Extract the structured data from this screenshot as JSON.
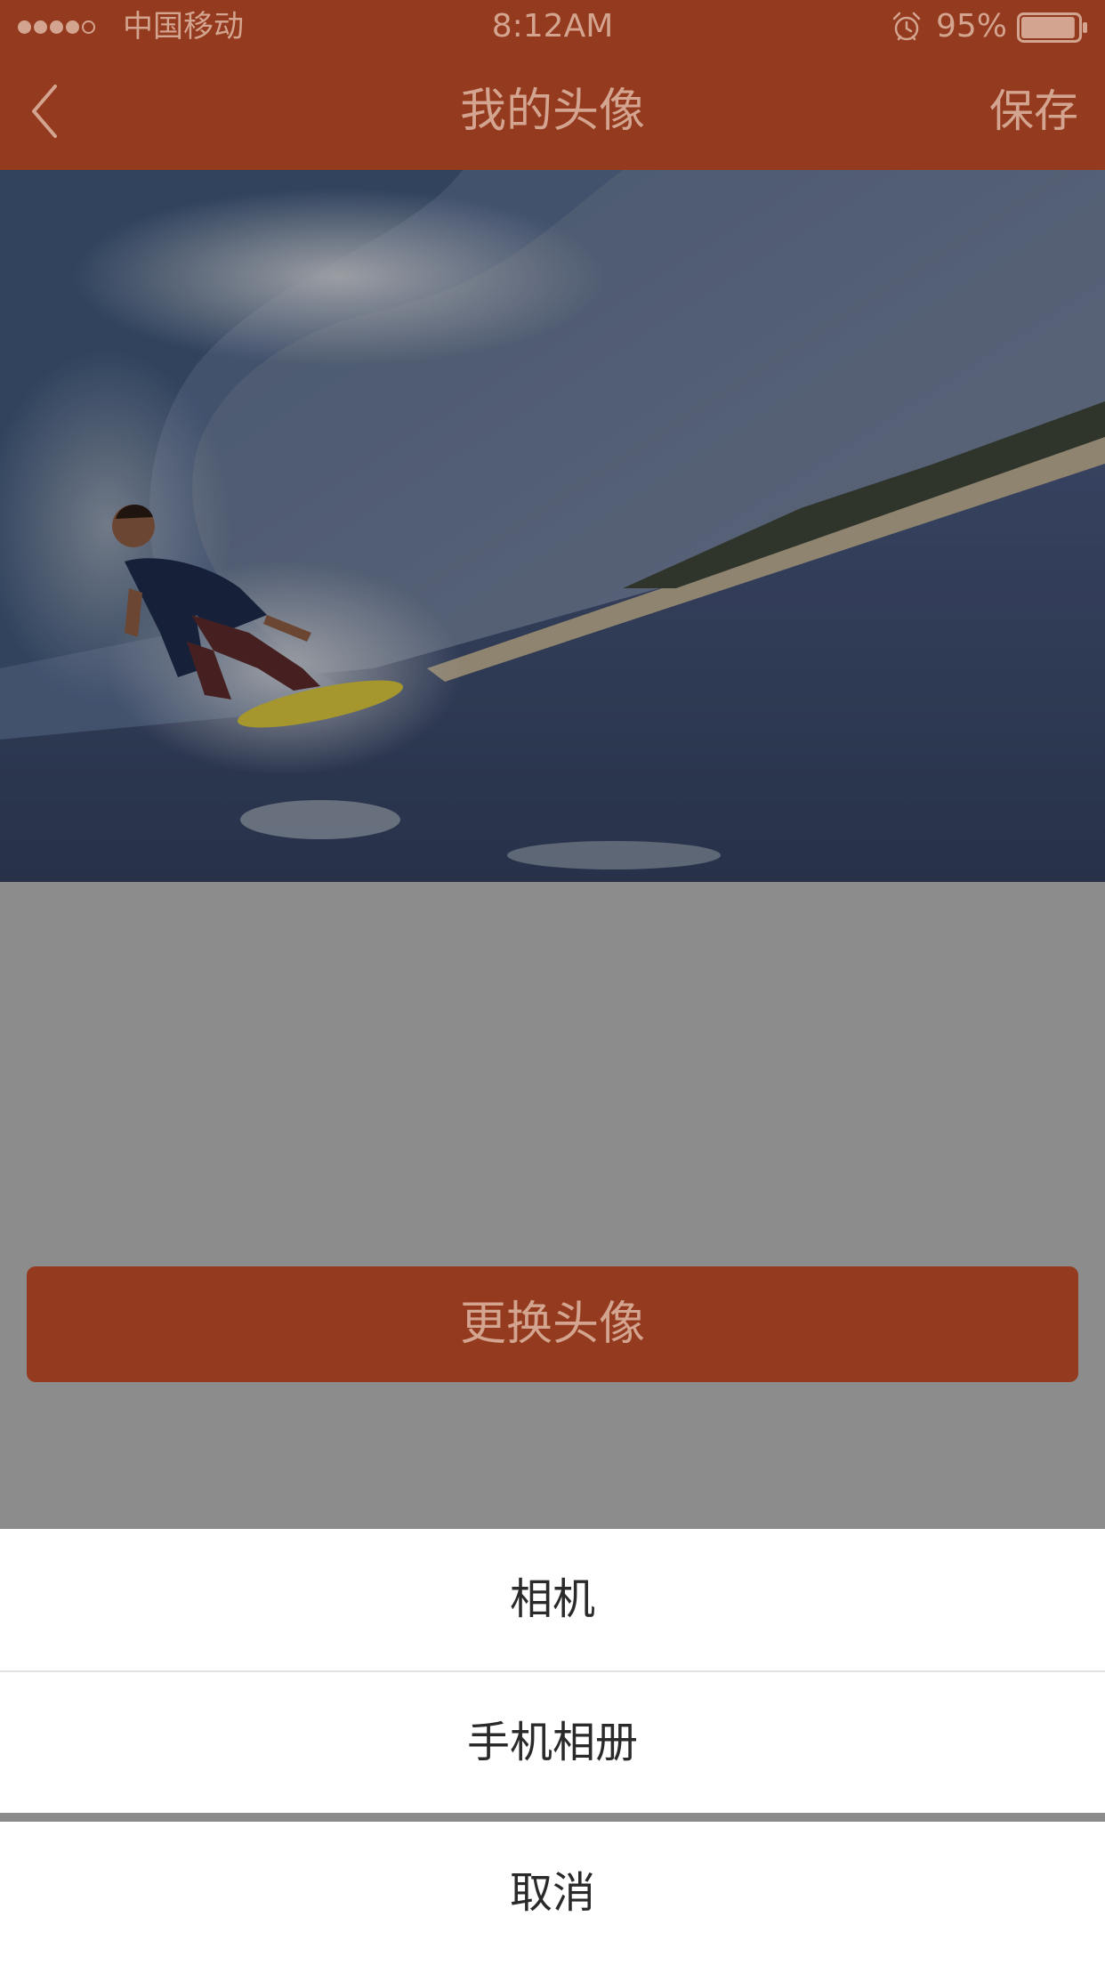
{
  "status_bar": {
    "signal_dots_filled": 4,
    "signal_dots_total": 5,
    "carrier": "中国移动",
    "time": "8:12AM",
    "alarm_icon": "alarm-clock-icon",
    "battery_percent": "95%",
    "battery_level": 0.95
  },
  "nav": {
    "back_icon": "chevron-left-icon",
    "title": "我的头像",
    "save_label": "保存"
  },
  "main": {
    "change_avatar_label": "更换头像"
  },
  "action_sheet": {
    "options": [
      {
        "label": "相机"
      },
      {
        "label": "手机相册"
      }
    ],
    "cancel_label": "取消"
  },
  "colors": {
    "nav_bar": "#943a1e",
    "nav_text": "#d3a48f",
    "dim_overlay": "#8c8c8c",
    "sheet_background": "#ffffff",
    "sheet_text": "#2a2a2a"
  }
}
